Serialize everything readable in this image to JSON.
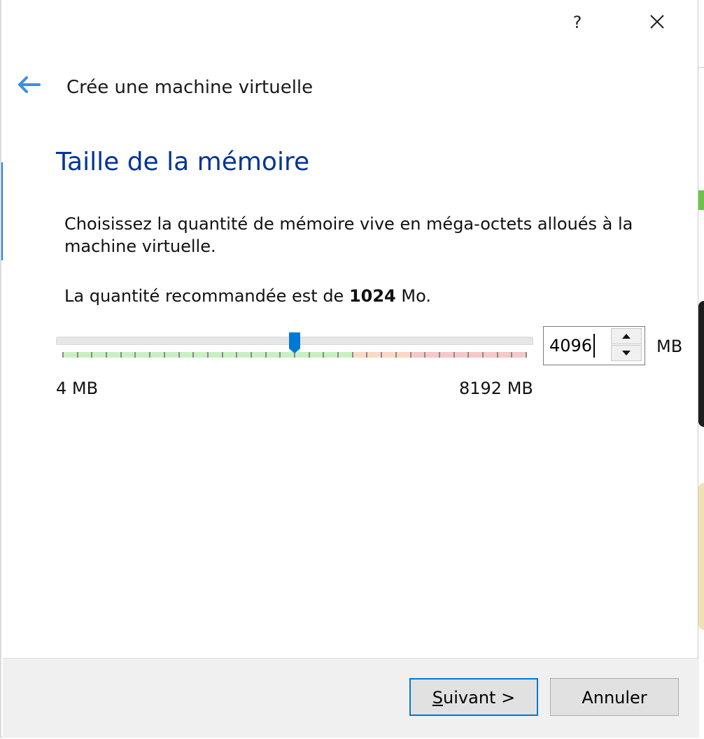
{
  "window": {
    "help_label": "?",
    "close_icon": "close-icon"
  },
  "header": {
    "back_icon": "arrow-left-icon",
    "title": "Crée une machine virtuelle"
  },
  "page": {
    "title": "Taille de la mémoire",
    "description": "Choisissez la quantité de mémoire vive en méga-octets alloués à la machine virtuelle.",
    "recommend_prefix": "La quantité recommandée est de ",
    "recommend_value": "1024",
    "recommend_suffix": " Mo."
  },
  "memory": {
    "value": "4096",
    "unit": "MB",
    "min_label": "4 MB",
    "max_label": "8192 MB",
    "min": 4,
    "max": 8192,
    "current": 4096,
    "recommended_zone_end": 5120,
    "warning_zone_end": 6144
  },
  "colors": {
    "accent": "#0078d7",
    "title": "#003399",
    "zone_ok": "#c8f0c0",
    "zone_warn": "#fbd9c4",
    "zone_bad": "#f7c8c8"
  },
  "footer": {
    "next_mnemonic": "S",
    "next_rest": "uivant >",
    "cancel_label": "Annuler"
  }
}
